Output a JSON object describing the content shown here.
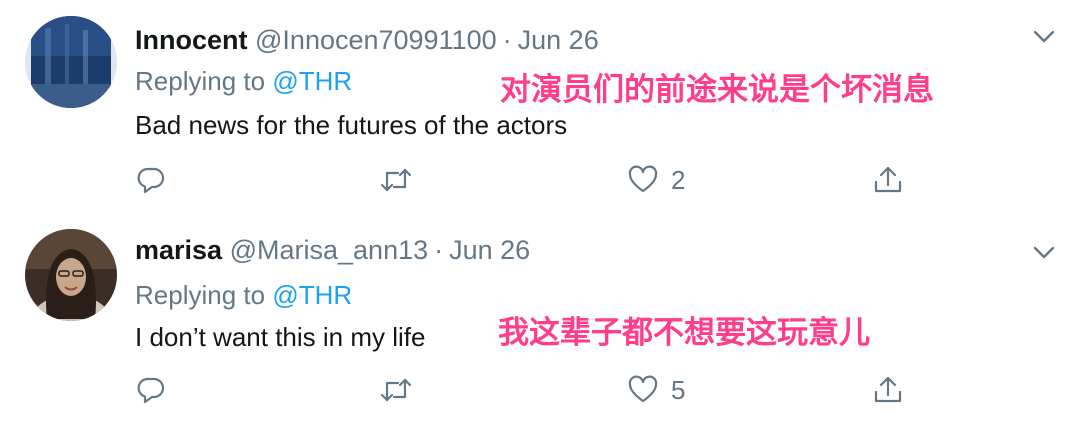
{
  "tweets": [
    {
      "name": "Innocent",
      "handle": "@Innocen70991100",
      "separator": "·",
      "date": "Jun 26",
      "replying_prefix": "Replying to ",
      "replying_to": "@THR",
      "text": "Bad news for the futures of the actors",
      "translation": "对演员们的前途来说是个坏消息",
      "like_count": "2",
      "avatar_colors": [
        "#1c3c6e",
        "#6b8fb5"
      ]
    },
    {
      "name": "marisa",
      "handle": "@Marisa_ann13",
      "separator": "·",
      "date": "Jun 26",
      "replying_prefix": "Replying to ",
      "replying_to": "@THR",
      "text": "I don’t want this in my life",
      "translation": "我这辈子都不想要这玩意儿",
      "like_count": "5",
      "avatar_colors": [
        "#3a2e26",
        "#c9a58a"
      ]
    }
  ],
  "colors": {
    "accent": "#1da1f2",
    "muted": "#657786",
    "translation": "#ff3d8b"
  }
}
